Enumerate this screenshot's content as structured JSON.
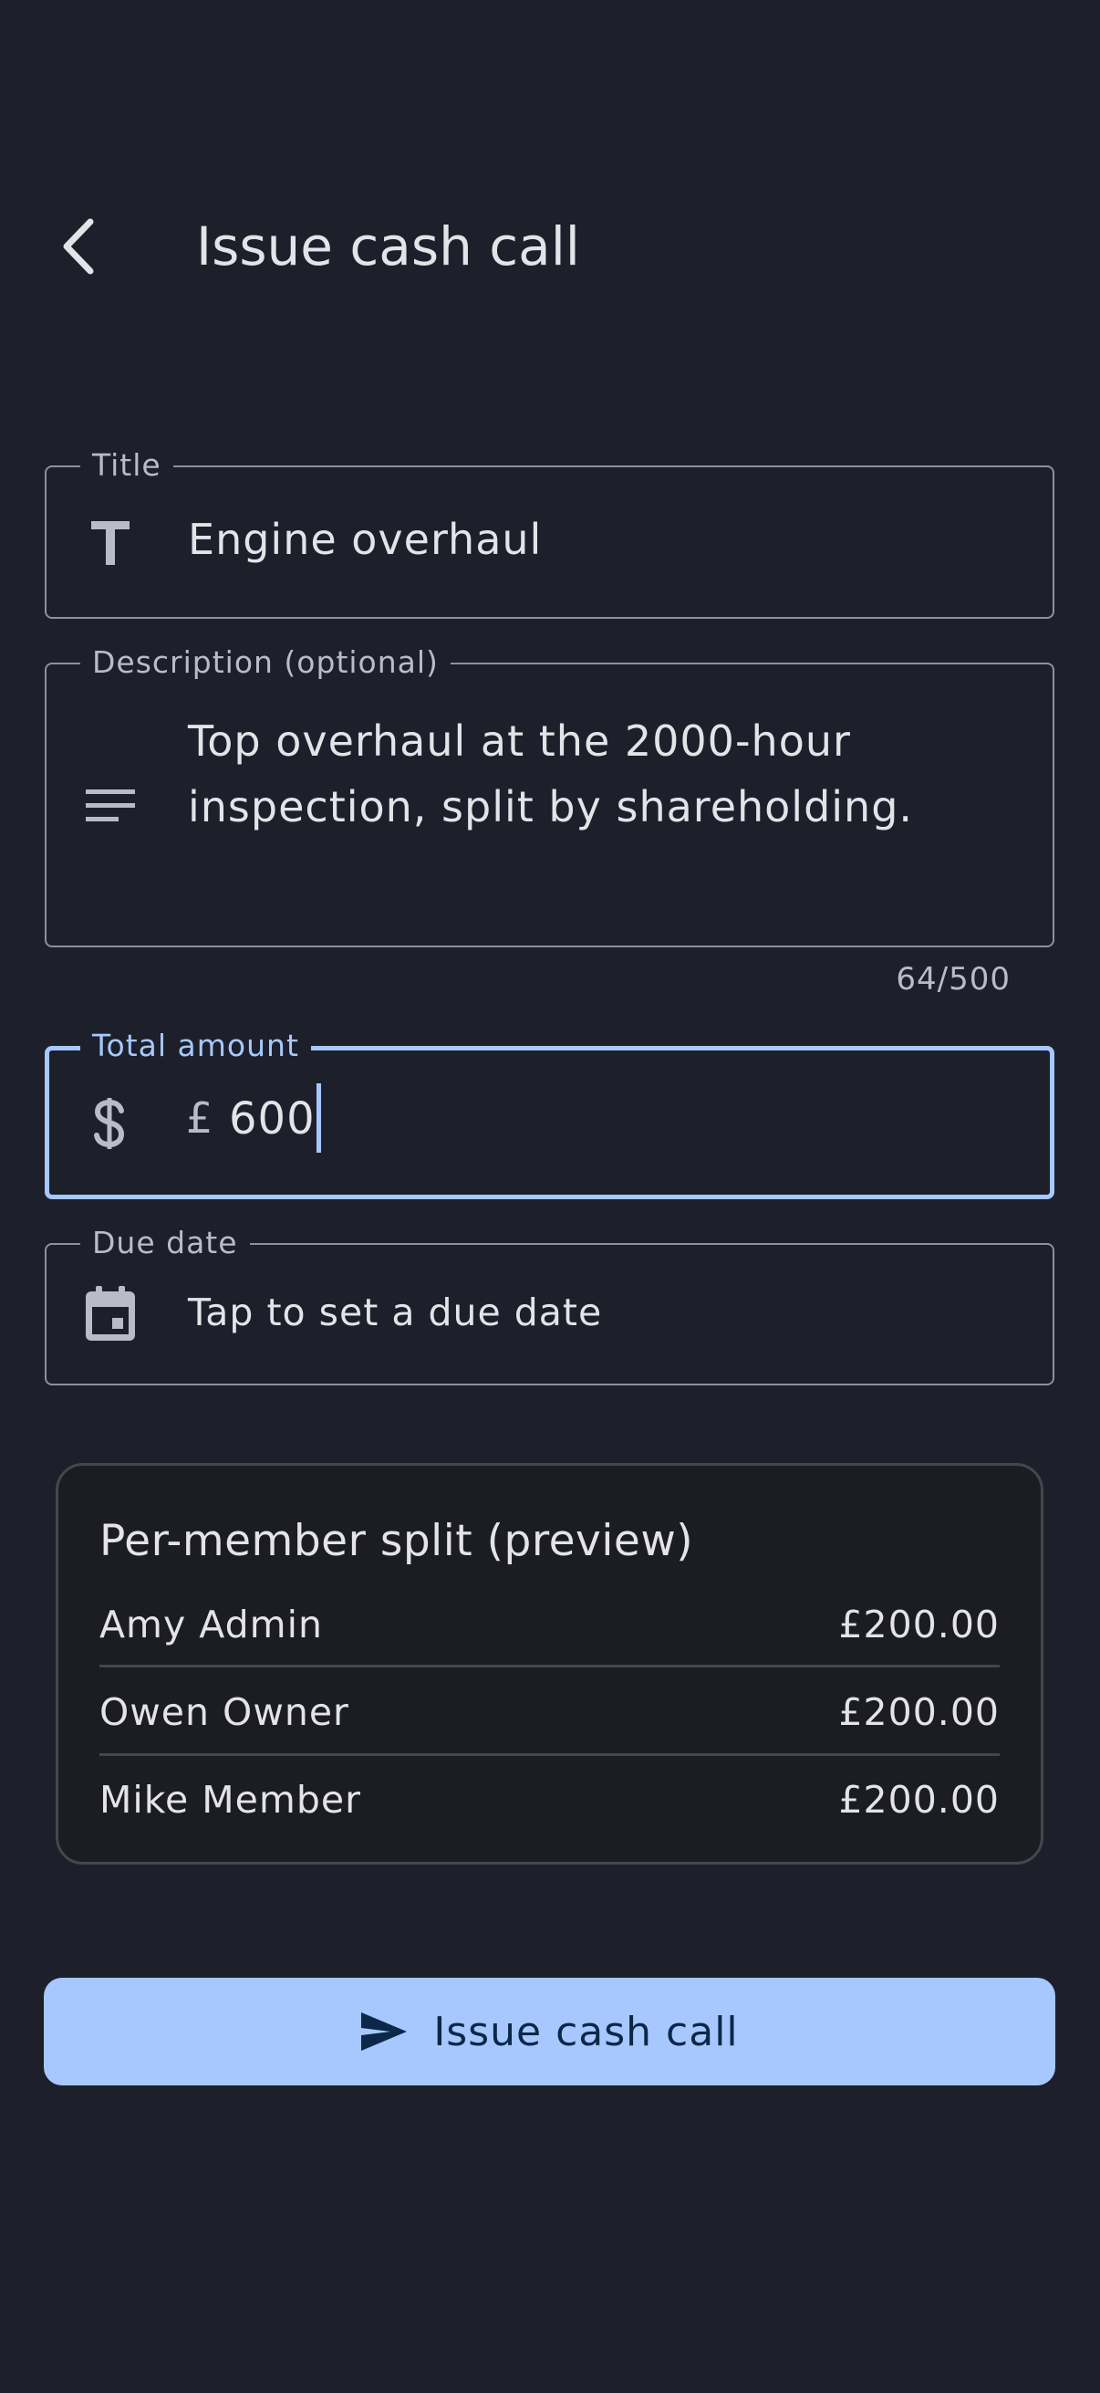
{
  "app_bar": {
    "back_icon": "chevron-left-icon",
    "title": "Issue cash call"
  },
  "form": {
    "title_field": {
      "label": "Title",
      "icon": "title-t-icon",
      "value": "Engine overhaul"
    },
    "description_field": {
      "label": "Description (optional)",
      "icon": "notes-lines-icon",
      "value": "Top overhaul at the 2000-hour inspection, split by shareholding.",
      "counter": "64/500"
    },
    "amount_field": {
      "label": "Total amount",
      "icon": "dollar-icon",
      "prefix": "£",
      "value": "600"
    },
    "due_date_field": {
      "label": "Due date",
      "icon": "calendar-icon",
      "value": "Tap to set a due date"
    }
  },
  "split_preview": {
    "title": "Per-member split (preview)",
    "rows": [
      {
        "name": "Amy Admin",
        "amount": "£200.00"
      },
      {
        "name": "Owen Owner",
        "amount": "£200.00"
      },
      {
        "name": "Mike Member",
        "amount": "£200.00"
      }
    ]
  },
  "submit_button": {
    "icon": "send-icon",
    "label": "Issue cash call"
  },
  "colors": {
    "background": "#1d202a",
    "accent": "#a6c8ff",
    "card_background": "#1b1d22",
    "outline": "#8e919a"
  }
}
